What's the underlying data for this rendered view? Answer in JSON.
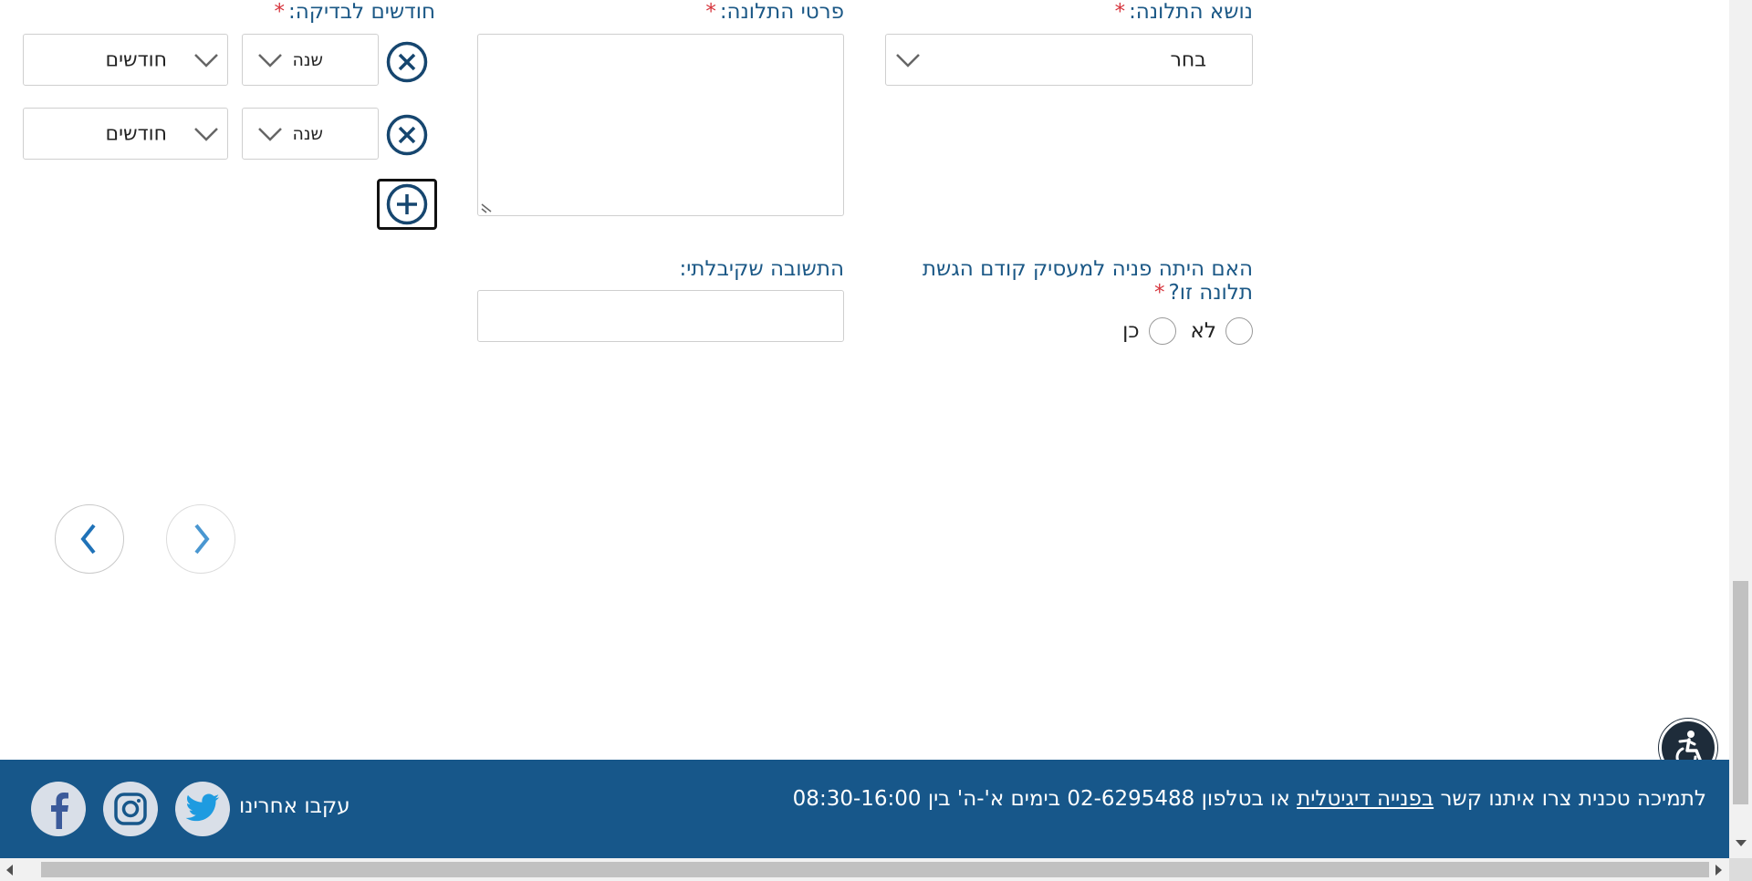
{
  "form": {
    "subject": {
      "label": "נושא התלונה:",
      "required_mark": "*",
      "value": "בחר"
    },
    "details": {
      "label": "פרטי התלונה:",
      "required_mark": "*",
      "value": ""
    },
    "months": {
      "label": "חודשים לבדיקה:",
      "required_mark": "*",
      "rows": [
        {
          "year_placeholder": "שנה",
          "months_placeholder": "חודשים"
        },
        {
          "year_placeholder": "שנה",
          "months_placeholder": "חודשים"
        }
      ]
    },
    "prior_contact": {
      "label_line1": "האם היתה פניה למעסיק קודם הגשת",
      "label_line2": "תלונה זו?",
      "required_mark": "*",
      "option_no": "לא",
      "option_yes": "כן"
    },
    "response": {
      "label": "התשובה שקיבלתי:",
      "value": ""
    }
  },
  "footer": {
    "support_prefix": "לתמיכה טכנית צרו איתנו קשר",
    "support_link": "בפנייה דיגיטלית",
    "support_suffix": "או בטלפון 02-6295488 בימים א'-ה' בין 08:30-16:00",
    "follow_label": "עקבו אחרינו",
    "social": [
      "twitter-icon",
      "instagram-icon",
      "facebook-icon"
    ]
  },
  "colors": {
    "primary": "#17578a",
    "label": "#1b5886",
    "required": "#d6343c",
    "icon": "#16466f"
  }
}
